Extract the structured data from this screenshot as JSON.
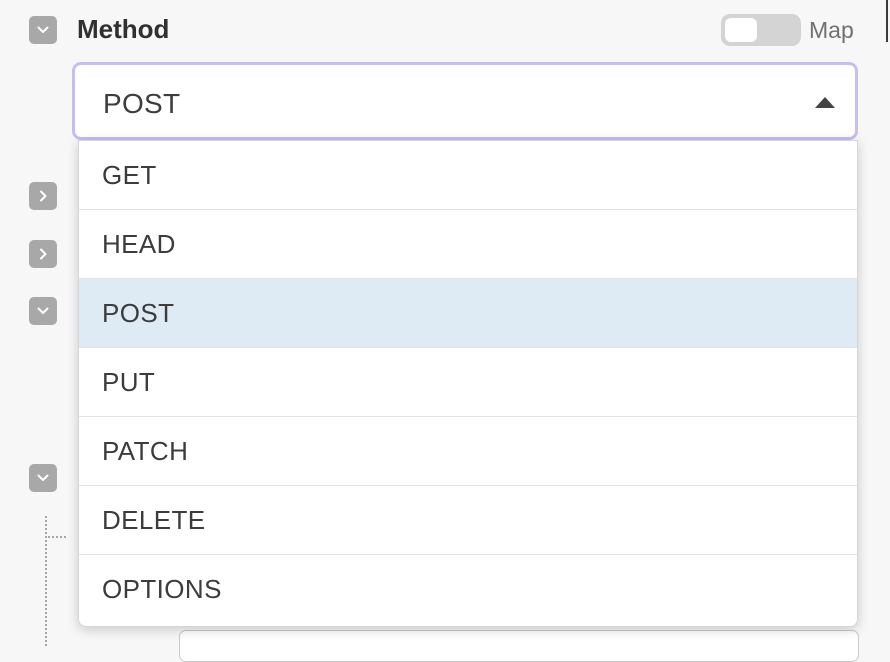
{
  "method_section": {
    "title": "Method",
    "map_label": "Map",
    "selected_value": "POST",
    "options": [
      "GET",
      "HEAD",
      "POST",
      "PUT",
      "PATCH",
      "DELETE",
      "OPTIONS"
    ],
    "selected_index": 2
  },
  "icons": {
    "expanded": "chevron-down-icon",
    "collapsed": "chevron-right-icon",
    "dropdown_open": "caret-up-icon"
  },
  "colors": {
    "focus_border": "#c9bcf0",
    "selected_option_bg": "#deebf5",
    "toggle_button_bg": "#a8a8a8"
  }
}
